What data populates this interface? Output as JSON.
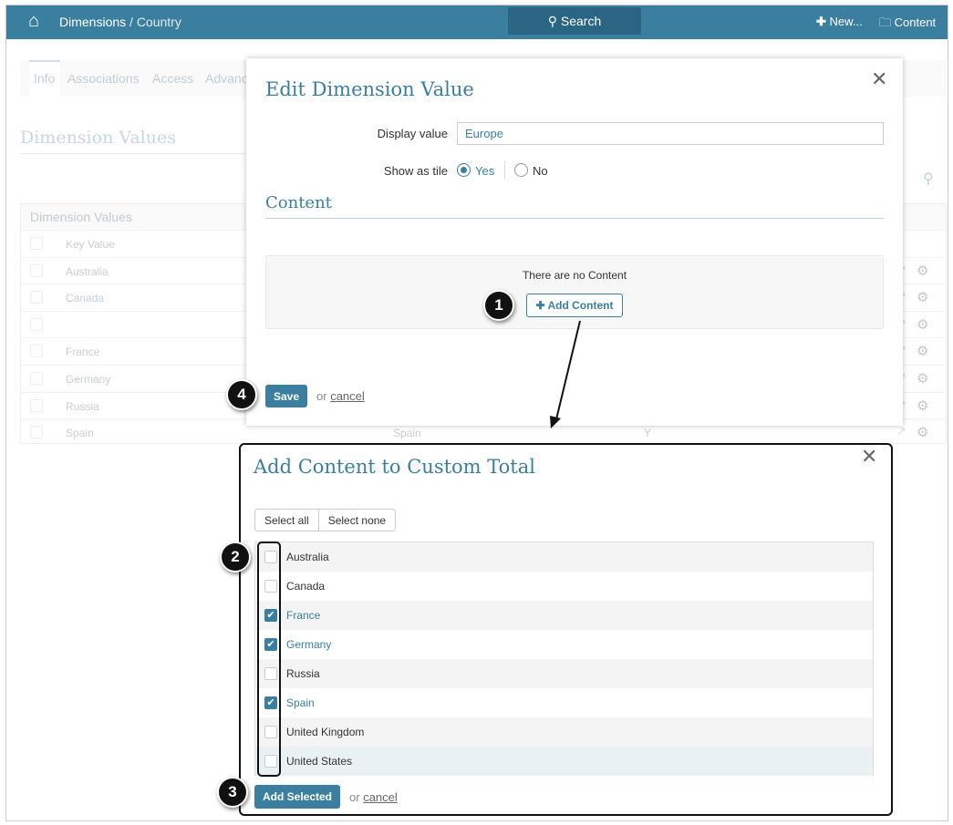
{
  "header": {
    "breadcrumb_root": "Dimensions",
    "breadcrumb_separator": " / ",
    "breadcrumb_current": "Country",
    "search_label": "Search",
    "new_label": "New...",
    "content_label": "Content"
  },
  "tabs": [
    "Info",
    "Associations",
    "Access",
    "Advanc"
  ],
  "background": {
    "section_title": "Dimension Values",
    "table_title": "Dimension Values",
    "column_key": "Key Value",
    "rows": [
      {
        "key": "Australia"
      },
      {
        "key": "Canada"
      },
      {
        "key": ""
      },
      {
        "key": "France"
      },
      {
        "key": "Germany"
      },
      {
        "key": "Russia"
      },
      {
        "key": "Spain",
        "col2": "Spain",
        "col3": "Y"
      }
    ]
  },
  "edit_modal": {
    "title": "Edit Dimension Value",
    "display_value_label": "Display value",
    "display_value": "Europe",
    "show_as_tile_label": "Show as tile",
    "yes_label": "Yes",
    "no_label": "No",
    "show_as_tile_selected": "Yes",
    "content_heading": "Content",
    "empty_message": "There are no Content",
    "add_content_label": "Add Content",
    "save_label": "Save",
    "or_label": "or",
    "cancel_label": "cancel"
  },
  "add_modal": {
    "title": "Add Content to Custom Total",
    "select_all": "Select all",
    "select_none": "Select none",
    "items": [
      {
        "label": "Australia",
        "checked": false
      },
      {
        "label": "Canada",
        "checked": false
      },
      {
        "label": "France",
        "checked": true
      },
      {
        "label": "Germany",
        "checked": true
      },
      {
        "label": "Russia",
        "checked": false
      },
      {
        "label": "Spain",
        "checked": true
      },
      {
        "label": "United Kingdom",
        "checked": false
      },
      {
        "label": "United States",
        "checked": false
      }
    ],
    "add_selected_label": "Add Selected",
    "or_label": "or",
    "cancel_label": "cancel"
  },
  "annotations": [
    "1",
    "2",
    "3",
    "4"
  ]
}
